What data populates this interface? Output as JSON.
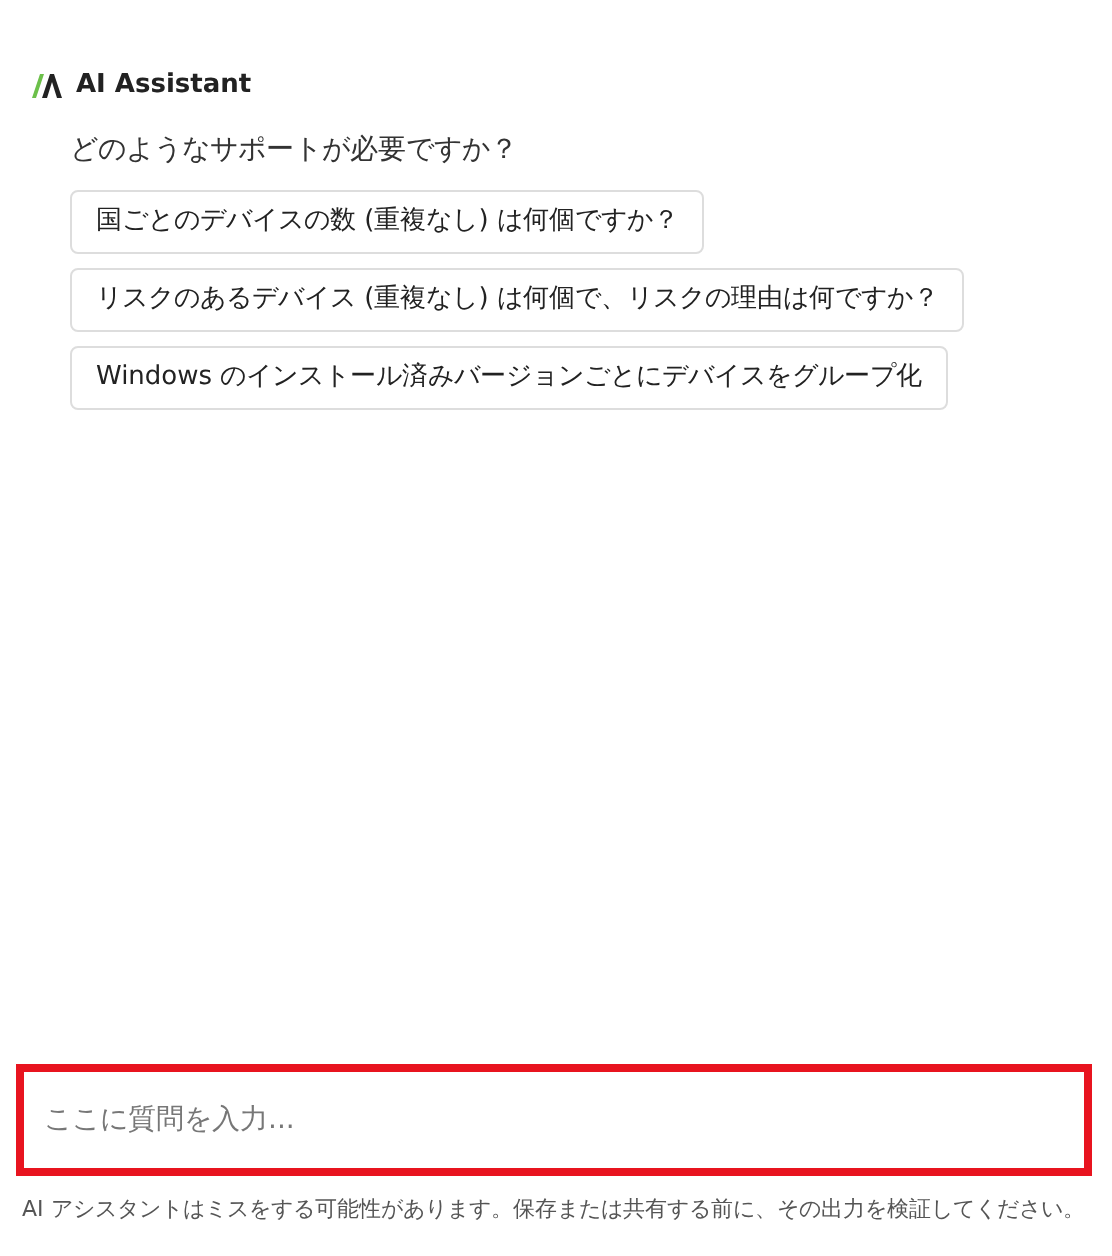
{
  "header": {
    "title": "AI Assistant"
  },
  "prompt": "どのようなサポートが必要ですか？",
  "suggestions": [
    "国ごとのデバイスの数 (重複なし) は何個ですか？",
    "リスクのあるデバイス (重複なし) は何個で、リスクの理由は何ですか？",
    "Windows のインストール済みバージョンごとにデバイスをグループ化"
  ],
  "input": {
    "placeholder": "ここに質問を入力..."
  },
  "disclaimer": "AI アシスタントはミスをする可能性があります。保存または共有する前に、その出力を検証してください。"
}
